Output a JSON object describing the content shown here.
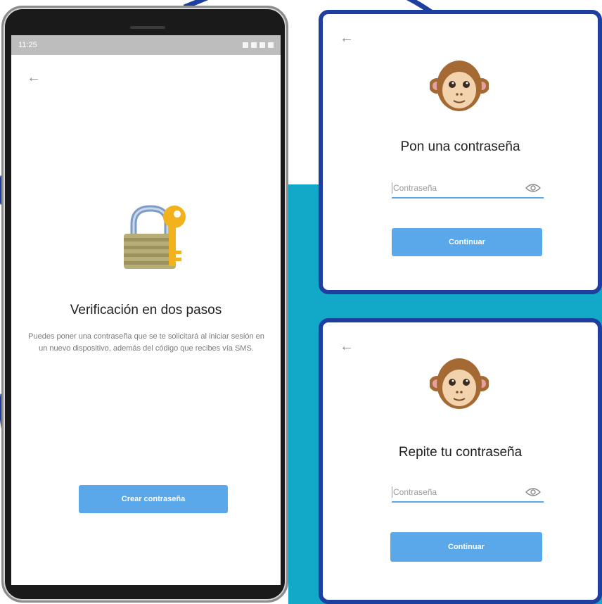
{
  "phone": {
    "status_time": "11:25",
    "back_icon": "arrow-left-icon",
    "illustration_icon": "lock-with-key-icon",
    "title": "Verificación en dos pasos",
    "description": "Puedes poner una contraseña que se te solicitará al iniciar sesión en un nuevo dispositivo, además del código que recibes vía SMS.",
    "button_label": "Crear contraseña"
  },
  "card_set_password": {
    "back_icon": "arrow-left-icon",
    "illustration_icon": "see-no-evil-monkey-icon",
    "title": "Pon una contraseña",
    "field_placeholder": "Contraseña",
    "field_icon": "eye-icon",
    "button_label": "Continuar"
  },
  "card_repeat_password": {
    "back_icon": "arrow-left-icon",
    "illustration_icon": "see-no-evil-monkey-icon",
    "title": "Repite tu contraseña",
    "field_placeholder": "Contraseña",
    "field_icon": "eye-icon",
    "button_label": "Continuar"
  },
  "colors": {
    "accent_blue": "#5aa8ea",
    "frame_navy": "#1f3fa0",
    "teal_background": "#12a9c8"
  }
}
